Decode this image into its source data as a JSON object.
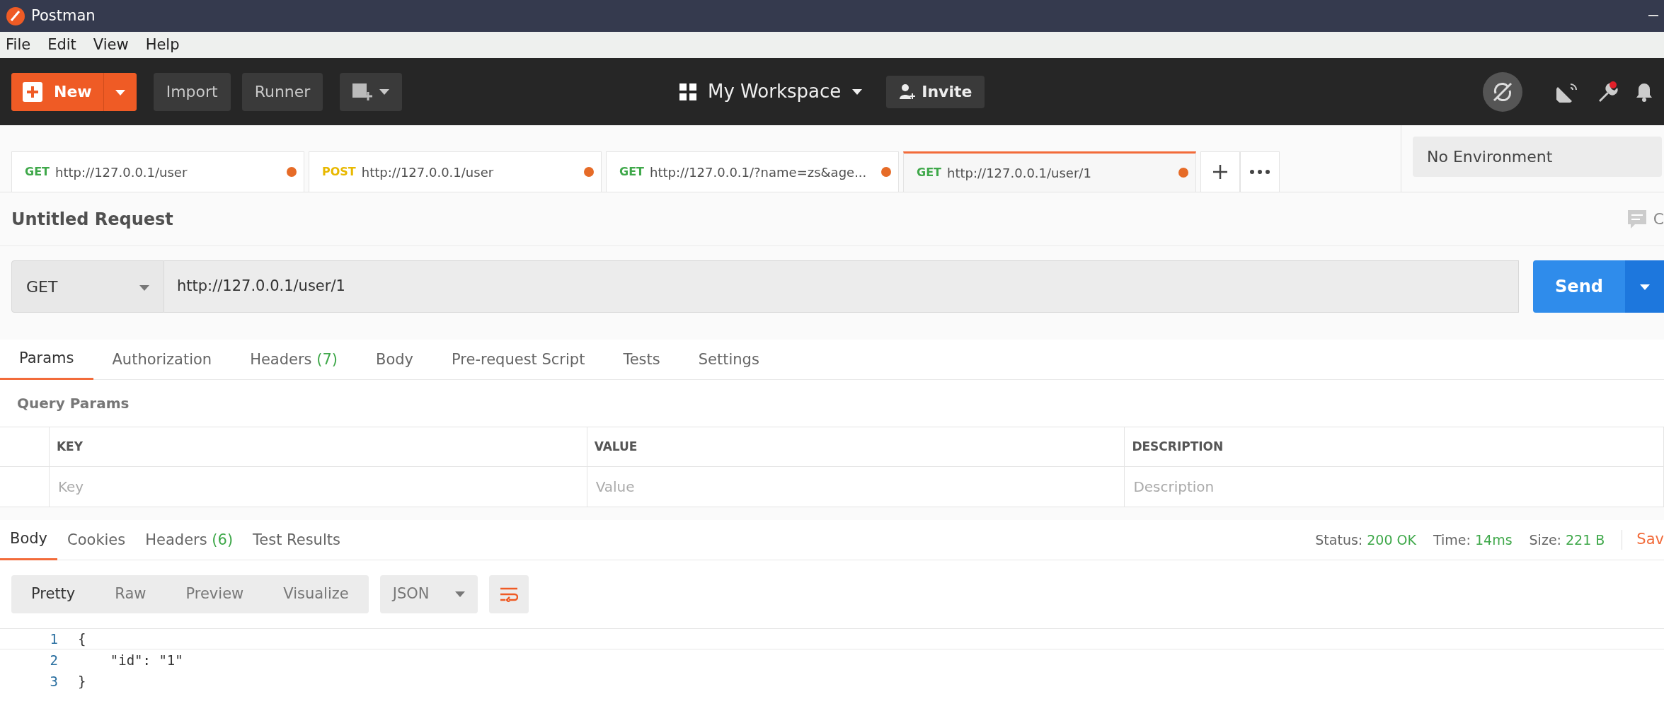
{
  "window": {
    "title": "Postman"
  },
  "menu": [
    "File",
    "Edit",
    "View",
    "Help"
  ],
  "toolbar": {
    "new_button": "New",
    "import_button": "Import",
    "runner_button": "Runner",
    "workspace": "My Workspace",
    "invite_button": "Invite"
  },
  "request_tabs": [
    {
      "method": "GET",
      "color": "#3fa84a",
      "url": "http://127.0.0.1/user",
      "unsaved": true,
      "selected": false
    },
    {
      "method": "POST",
      "color": "#e8b800",
      "url": "http://127.0.0.1/user",
      "unsaved": true,
      "selected": false
    },
    {
      "method": "GET",
      "color": "#3fa84a",
      "url": "http://127.0.0.1/?name=zs&age...",
      "unsaved": true,
      "selected": false
    },
    {
      "method": "GET",
      "color": "#3fa84a",
      "url": "http://127.0.0.1/user/1",
      "unsaved": true,
      "selected": true
    }
  ],
  "environment": "No Environment",
  "request": {
    "title": "Untitled Request",
    "comments_label": "C",
    "method": "GET",
    "url": "http://127.0.0.1/user/1",
    "send_button": "Send"
  },
  "request_sections": [
    {
      "label": "Params",
      "selected": true
    },
    {
      "label": "Authorization",
      "selected": false
    },
    {
      "label": "Headers",
      "count": "(7)",
      "selected": false
    },
    {
      "label": "Body",
      "selected": false
    },
    {
      "label": "Pre-request Script",
      "selected": false
    },
    {
      "label": "Tests",
      "selected": false
    },
    {
      "label": "Settings",
      "selected": false
    }
  ],
  "query_params": {
    "title": "Query Params",
    "columns": [
      "KEY",
      "VALUE",
      "DESCRIPTION"
    ],
    "placeholders": [
      "Key",
      "Value",
      "Description"
    ]
  },
  "response_sections": [
    {
      "label": "Body",
      "selected": true
    },
    {
      "label": "Cookies",
      "selected": false
    },
    {
      "label": "Headers",
      "count": "(6)",
      "selected": false
    },
    {
      "label": "Test Results",
      "selected": false
    }
  ],
  "response_status": [
    {
      "label": "Status:",
      "value": "200 OK"
    },
    {
      "label": "Time:",
      "value": "14ms"
    },
    {
      "label": "Size:",
      "value": "221 B"
    }
  ],
  "save_response": "Sav",
  "view_modes": [
    {
      "label": "Pretty",
      "selected": true
    },
    {
      "label": "Raw",
      "selected": false
    },
    {
      "label": "Preview",
      "selected": false
    },
    {
      "label": "Visualize",
      "selected": false
    }
  ],
  "format": "JSON",
  "code_lines": [
    {
      "number": "1",
      "text": "{",
      "current": true
    },
    {
      "number": "2",
      "text": "    \"id\": \"1\"",
      "current": false
    },
    {
      "number": "3",
      "text": "}",
      "current": false
    }
  ]
}
